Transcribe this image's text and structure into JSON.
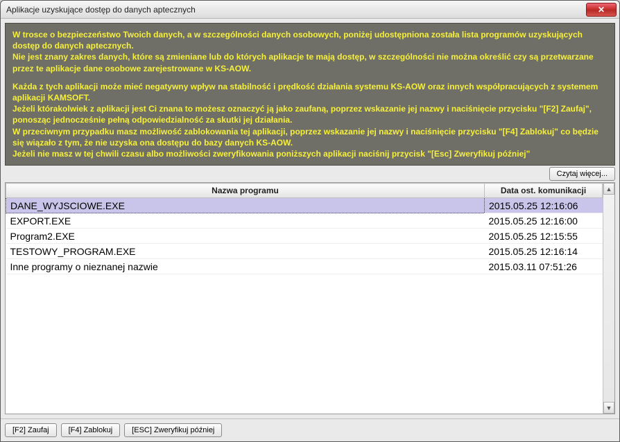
{
  "window": {
    "title": "Aplikacje uzyskujące dostęp do danych aptecznych"
  },
  "notice": {
    "p1": "W trosce o bezpieczeństwo Twoich danych, a w szczególności danych osobowych, poniżej udostępniona została lista programów uzyskujących dostęp do danych aptecznych.\nNie jest znany zakres danych, które są zmieniane lub do których aplikacje te mają dostęp, w szczególności nie można określić czy są przetwarzane przez te aplikacje dane osobowe zarejestrowane w KS-AOW.",
    "p2": "Każda z tych aplikacji może mieć negatywny wpływ na stabilność i prędkość działania systemu KS-AOW oraz innych współpracujących z systemem aplikacji KAMSOFT.\nJeżeli którakolwiek z aplikacji jest Ci znana to możesz oznaczyć ją jako zaufaną, poprzez wskazanie jej nazwy i naciśnięcie przycisku \"[F2] Zaufaj\", ponosząc jednocześnie pełną odpowiedzialność za skutki jej działania.\nW przeciwnym przypadku masz możliwość zablokowania tej aplikacji, poprzez wskazanie jej nazwy i naciśnięcie przycisku \"[F4] Zablokuj\" co będzie się wiązało z tym, że nie uzyska ona dostępu do bazy danych KS-AOW.\nJeżeli nie masz w tej chwili czasu albo możliwości zweryfikowania poniższych aplikacji naciśnij przycisk \"[Esc] Zweryfikuj później\""
  },
  "buttons": {
    "read_more": "Czytaj więcej...",
    "trust": "[F2] Zaufaj",
    "block": "[F4] Zablokuj",
    "later": "[ESC] Zweryfikuj później"
  },
  "table": {
    "col_name": "Nazwa programu",
    "col_date": "Data ost. komunikacji",
    "rows": [
      {
        "name": "DANE_WYJSCIOWE.EXE",
        "date": "2015.05.25 12:16:06",
        "selected": true
      },
      {
        "name": "EXPORT.EXE",
        "date": "2015.05.25 12:16:00",
        "selected": false
      },
      {
        "name": "Program2.EXE",
        "date": "2015.05.25 12:15:55",
        "selected": false
      },
      {
        "name": "TESTOWY_PROGRAM.EXE",
        "date": "2015.05.25 12:16:14",
        "selected": false
      },
      {
        "name": "Inne programy o nieznanej nazwie",
        "date": "2015.03.11 07:51:26",
        "selected": false
      }
    ]
  }
}
